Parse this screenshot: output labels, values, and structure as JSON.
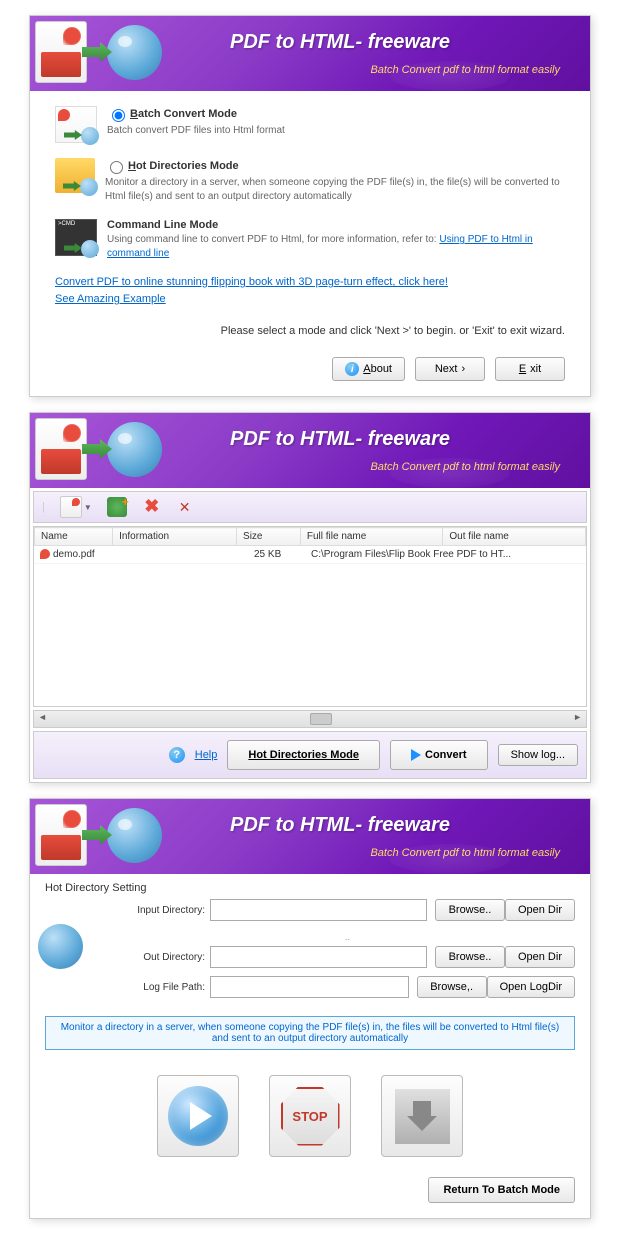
{
  "header": {
    "title": "PDF to HTML- freeware",
    "subtitle": "Batch Convert pdf to html format easily"
  },
  "panel1": {
    "modes": [
      {
        "key": "B",
        "title": "atch Convert Mode",
        "desc": "Batch convert PDF files into Html format",
        "checked": true
      },
      {
        "key": "H",
        "title": "ot Directories Mode",
        "desc": "Monitor a directory in a server, when someone copying the PDF file(s) in, the file(s) will be converted to Html file(s) and sent to an output directory automatically",
        "checked": false
      },
      {
        "key": "",
        "title": "Command Line Mode",
        "desc_prefix": "Using command line to convert PDF to Html, for more information, refer to:  ",
        "desc_link": "Using PDF to Html in command line",
        "checked": false,
        "no_radio": true
      }
    ],
    "link1": "Convert PDF to online stunning flipping book with 3D page-turn effect, click here!",
    "link2": "See Amazing Example ",
    "instruction": "Please select a mode and click 'Next >' to begin. or 'Exit' to exit wizard.",
    "about_key": "A",
    "about": "bout",
    "next": "Next",
    "exit_key": "E",
    "exit": "xit"
  },
  "panel2": {
    "columns": [
      "Name",
      "Information",
      "Size",
      "Full file name",
      "Out file name"
    ],
    "rows": [
      {
        "name": "demo.pdf",
        "info": "",
        "size": "25 KB",
        "full": "C:\\Program Files\\Flip Book Free PDF to HT...",
        "out": ""
      }
    ],
    "help_key": "H",
    "help": "elp",
    "hotdir": "Hot Directories Mode",
    "convert": "Convert",
    "showlog": "Show log..."
  },
  "panel3": {
    "section": "Hot Directory Setting",
    "fields": [
      {
        "label": "Input Directory:",
        "b1": "Browse..",
        "b2": "Open Dir"
      },
      {
        "label": "Out Directory:",
        "b1": "Browse..",
        "b2": "Open Dir"
      },
      {
        "label": "Log File Path:",
        "b1": "Browse,.",
        "b2": "Open LogDir"
      }
    ],
    "dots": "..",
    "info": "Monitor a directory in a server, when someone copying the PDF file(s) in, the files will be converted to Html file(s) and sent to an output directory automatically",
    "stop": "STOP",
    "return": "Return To Batch Mode"
  }
}
